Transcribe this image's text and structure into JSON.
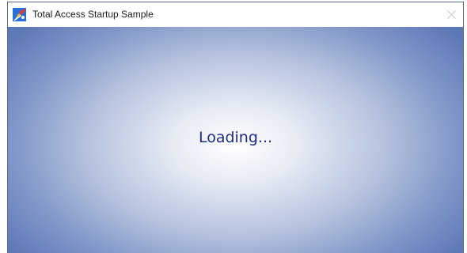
{
  "window": {
    "title": "Total Access Startup Sample",
    "icons": {
      "app": "app-icon",
      "close": "close-icon"
    }
  },
  "content": {
    "status_text": "Loading..."
  },
  "colors": {
    "gradient_center": "#ffffff",
    "gradient_edge": "#5d78b7",
    "status_text": "#1f2a86",
    "close_glyph": "#c8c8c8"
  }
}
